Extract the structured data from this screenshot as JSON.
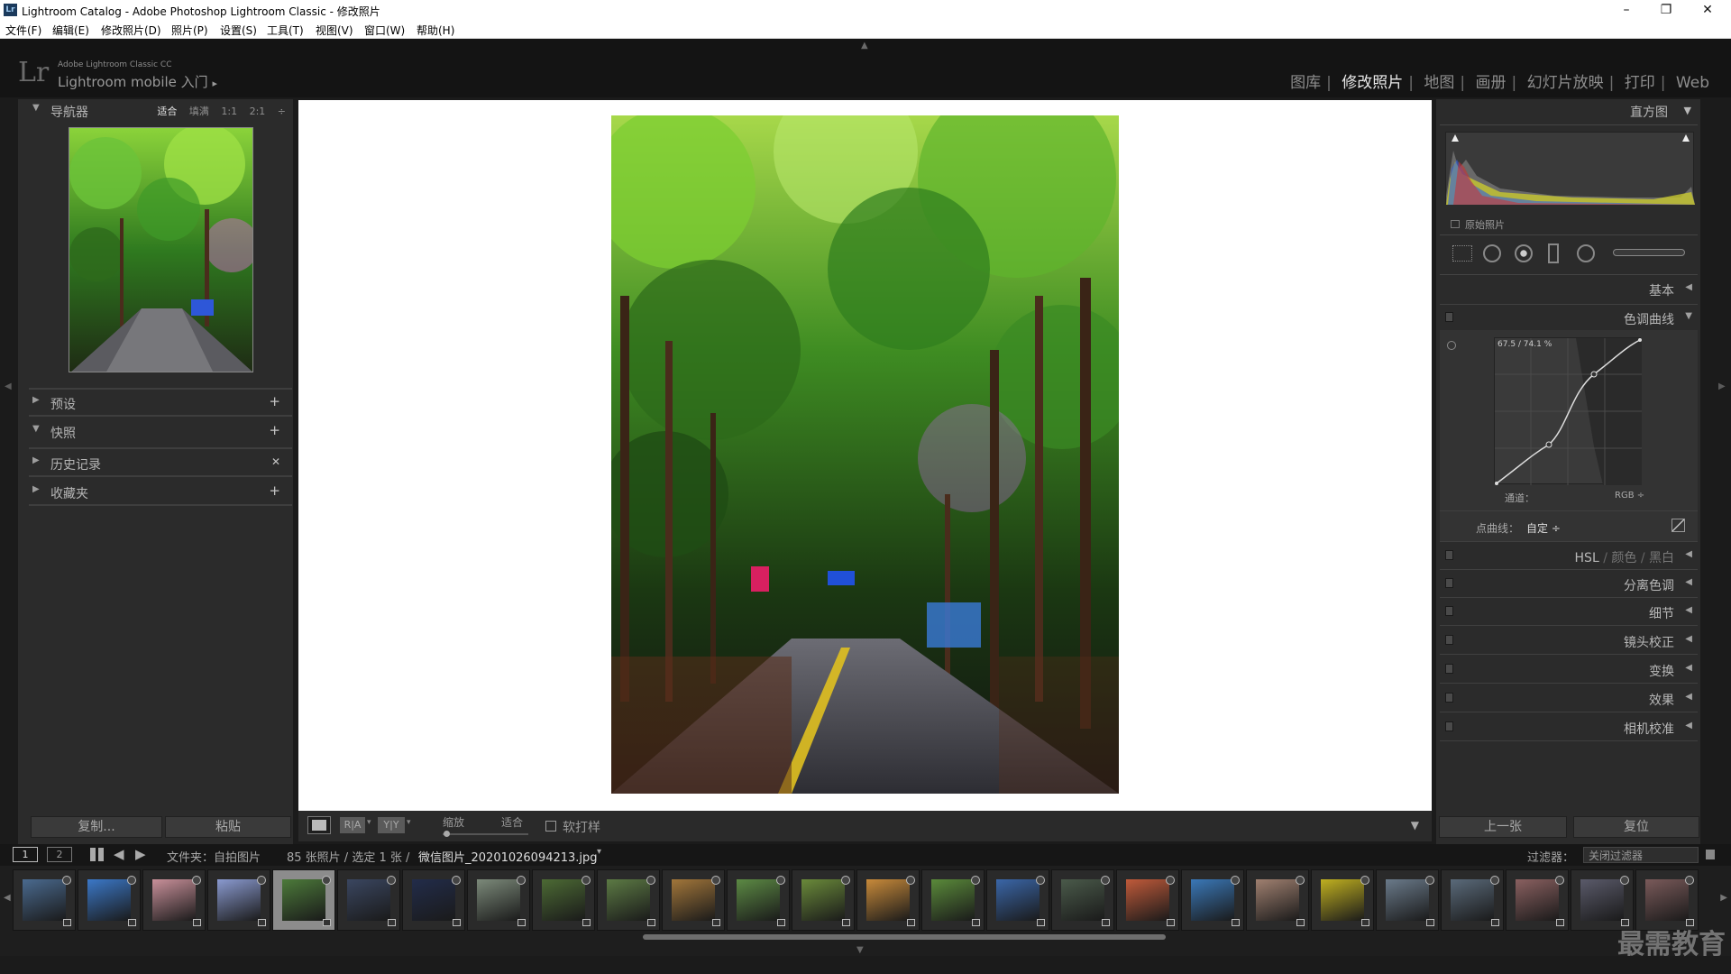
{
  "window": {
    "title": "Lightroom Catalog - Adobe Photoshop Lightroom Classic - 修改照片",
    "icon_text": "Lr",
    "minimize": "–",
    "restore": "❐",
    "close": "✕"
  },
  "menu": [
    "文件(F)",
    "编辑(E)",
    "修改照片(D)",
    "照片(P)",
    "设置(S)",
    "工具(T)",
    "视图(V)",
    "窗口(W)",
    "帮助(H)"
  ],
  "identity": {
    "logo": "Lr",
    "product": "Adobe Lightroom Classic CC",
    "mobile": "Lightroom mobile 入门",
    "mobile_arrow": "▸"
  },
  "modules": [
    {
      "label": "图库",
      "active": false
    },
    {
      "label": "修改照片",
      "active": true
    },
    {
      "label": "地图",
      "active": false
    },
    {
      "label": "画册",
      "active": false
    },
    {
      "label": "幻灯片放映",
      "active": false
    },
    {
      "label": "打印",
      "active": false
    },
    {
      "label": "Web",
      "active": false
    }
  ],
  "left": {
    "navigator": {
      "label": "导航器",
      "modes": [
        "适合",
        "填满",
        "1:1",
        "2:1"
      ],
      "mode_menu": "÷"
    },
    "presets": {
      "label": "预设",
      "action": "+"
    },
    "snapshots": {
      "label": "快照",
      "action": "+"
    },
    "history": {
      "label": "历史记录",
      "action": "✕"
    },
    "collections": {
      "label": "收藏夹",
      "action": "+"
    },
    "copy_button": "复制...",
    "paste_button": "粘贴"
  },
  "toolbar": {
    "zoom_label": "缩放",
    "zoom_value": "适合",
    "softproof_label": "软打样",
    "view_ra": "R|A",
    "view_yy": "Y|Y"
  },
  "right": {
    "histogram": {
      "label": "直方图",
      "original_photo": "原始照片"
    },
    "basic": "基本",
    "tone_curve": {
      "label": "色调曲线",
      "readout": "67.5 / 74.1 %",
      "channel_label": "通道：",
      "channel_value": "RGB",
      "point_curve_label": "点曲线：",
      "point_curve_value": "自定"
    },
    "hsl": {
      "hsl": "HSL",
      "color": "颜色",
      "bw": "黑白",
      "sep": "/"
    },
    "split_toning": "分离色调",
    "detail": "细节",
    "lens_corrections": "镜头校正",
    "transform": "变换",
    "effects": "效果",
    "calibration": "相机校准",
    "previous_button": "上一张",
    "reset_button": "复位"
  },
  "filmstrip": {
    "page1": "1",
    "page2": "2",
    "source": "文件夹：自拍图片",
    "count": "85 张照片 / 选定 1 张 /",
    "filename": "微信图片_20201026094213.jpg",
    "filter_label": "过滤器：",
    "filter_value": "关闭过滤器",
    "thumb_colors": [
      "#4a6a8f",
      "#3b78c8",
      "#c9909a",
      "#8a9ad0",
      "#4c7a3a",
      "#3a4660",
      "#222c4a",
      "#7c8a7a",
      "#4c6a34",
      "#5c7a44",
      "#a2763a",
      "#5c8a44",
      "#6a8a3a",
      "#c88a3a",
      "#5a8a3a",
      "#3a66a8",
      "#4a5a4a",
      "#c05a3a",
      "#3a78b8",
      "#a08070",
      "#c0b020",
      "#6a7a8a",
      "#5a6a7a",
      "#8a6060",
      "#5a5a6a",
      "#7a5a5a",
      "#4a8a3a"
    ]
  },
  "watermark": "最需教育",
  "colors": {
    "panel_bg": "#2b2b2b",
    "app_bg": "#1b1b1b",
    "active_module": "#e8e8e8",
    "inactive_module": "#8d8d8d"
  }
}
